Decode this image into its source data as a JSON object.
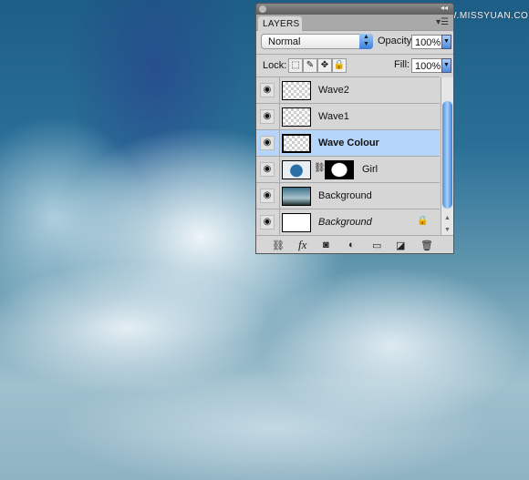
{
  "watermark": "思缘设计论坛 WWW.MISSYUAN.COM",
  "panel": {
    "tab": "LAYERS",
    "blend_mode": "Normal",
    "opacity_label": "Opacity:",
    "opacity": "100%",
    "lock_label": "Lock:",
    "fill_label": "Fill:",
    "fill": "100%",
    "layers": [
      {
        "name": "Wave2",
        "visible": true
      },
      {
        "name": "Wave1",
        "visible": true
      },
      {
        "name": "Wave Colour",
        "visible": true,
        "selected": true
      },
      {
        "name": "Girl",
        "visible": true,
        "has_mask": true
      },
      {
        "name": "Background",
        "visible": true
      },
      {
        "name": "Background",
        "visible": true,
        "locked": true
      }
    ],
    "icons": {
      "link": "⛓",
      "fx": "fx",
      "mask": "◙",
      "adjust": "◐",
      "folder": "▭",
      "new": "◪",
      "trash": "🗑"
    }
  },
  "colors": {
    "selected_row": "#b5d5fb",
    "accent": "#3a7fd8"
  }
}
